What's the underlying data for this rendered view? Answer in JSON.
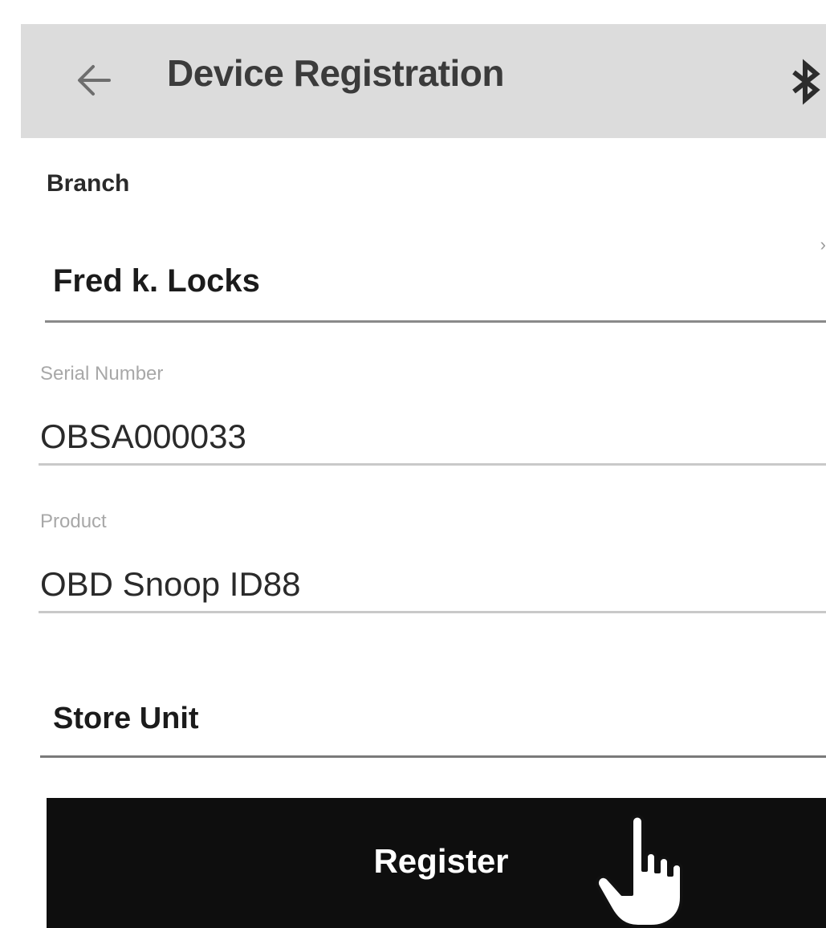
{
  "appbar": {
    "title": "Device Registration",
    "back_icon": "arrow-left-icon",
    "bluetooth_icon": "bluetooth-icon"
  },
  "form": {
    "branch": {
      "label": "Branch",
      "selected": "Fred k. Locks"
    },
    "serial_number": {
      "label": "Serial Number",
      "value": "OBSA000033"
    },
    "product": {
      "label": "Product",
      "value": "OBD Snoop ID88"
    },
    "store_unit": {
      "value": "Store Unit"
    }
  },
  "actions": {
    "register_label": "Register"
  },
  "colors": {
    "appbar_bg": "#dcdcdc",
    "button_bg": "#0e0e0e",
    "button_text": "#ffffff"
  }
}
